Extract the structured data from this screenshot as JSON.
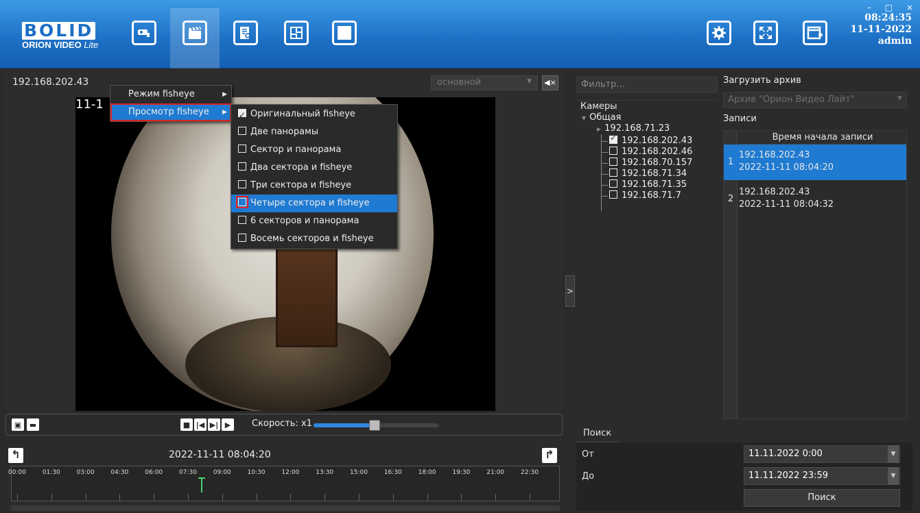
{
  "app": {
    "logo_text": "BOLID",
    "logo_sub": "ORION VIDEO",
    "logo_sub_italic": "Lite"
  },
  "toolbar": {
    "icons": [
      "camera-icon",
      "clapperboard-icon",
      "document-search-icon",
      "plan-icon",
      "window-icon",
      "settings-icon",
      "fullscreen-icon",
      "add-window-icon"
    ]
  },
  "window_controls": {
    "minimize": "–",
    "maximize": "□",
    "close": "×"
  },
  "clock": {
    "time": "08:24:35",
    "date": "11-11-2022",
    "user": "admin"
  },
  "video": {
    "camera_title": "192.168.202.43",
    "overlay_timestamp": "11-1",
    "stream": "основной",
    "mute_icon": "mute-icon"
  },
  "context_menu": {
    "items": [
      {
        "label": "Режим fisheye"
      },
      {
        "label": "Просмотр fisheye"
      }
    ],
    "submenu": [
      {
        "label": "Оригинальный fisheye",
        "checked": true
      },
      {
        "label": "Две панорамы",
        "checked": false
      },
      {
        "label": "Сектор и панорама",
        "checked": false
      },
      {
        "label": "Два сектора и fisheye",
        "checked": false
      },
      {
        "label": "Три сектора и fisheye",
        "checked": false
      },
      {
        "label": "Четыре сектора и fisheye",
        "checked": false
      },
      {
        "label": "6 секторов и панорама",
        "checked": false
      },
      {
        "label": "Восемь секторов и fisheye",
        "checked": false
      }
    ]
  },
  "playback": {
    "speed_label": "Скорость: x1",
    "speed_fraction": 0.49,
    "current_time": "2022-11-11 08:04:20",
    "timeline_ticks": [
      "00:00",
      "01:30",
      "03:00",
      "04:30",
      "06:00",
      "07:30",
      "09:00",
      "10:30",
      "12:00",
      "13:30",
      "15:00",
      "16:30",
      "18:00",
      "19:30",
      "21:00",
      "22:30"
    ],
    "marker_time": "08:04"
  },
  "cameras": {
    "filter_placeholder": "Фильтр...",
    "header": "Камеры",
    "group": "Общая",
    "subnode": "192.168.71.23",
    "items": [
      {
        "ip": "192.168.202.43",
        "checked": true
      },
      {
        "ip": "192.168.202.46",
        "checked": false
      },
      {
        "ip": "192.168.70.157",
        "checked": false
      },
      {
        "ip": "192.168.71.34",
        "checked": false
      },
      {
        "ip": "192.168.71.35",
        "checked": false
      },
      {
        "ip": "192.168.71.7",
        "checked": false
      }
    ]
  },
  "archive": {
    "label": "Загрузить архив",
    "selected": "Архив \"Орион Видео Лайт\""
  },
  "records": {
    "label": "Записи",
    "column": "Время начала записи",
    "rows": [
      {
        "num": "1",
        "camera": "192.168.202.43",
        "time": "2022-11-11 08:04:20",
        "selected": true
      },
      {
        "num": "2",
        "camera": "192.168.202.43",
        "time": "2022-11-11 08:04:32",
        "selected": false
      }
    ]
  },
  "search": {
    "tab": "Поиск",
    "from_label": "От",
    "from_value": "11.11.2022 0:00",
    "to_label": "До",
    "to_value": "11.11.2022 23:59",
    "button": "Поиск"
  }
}
